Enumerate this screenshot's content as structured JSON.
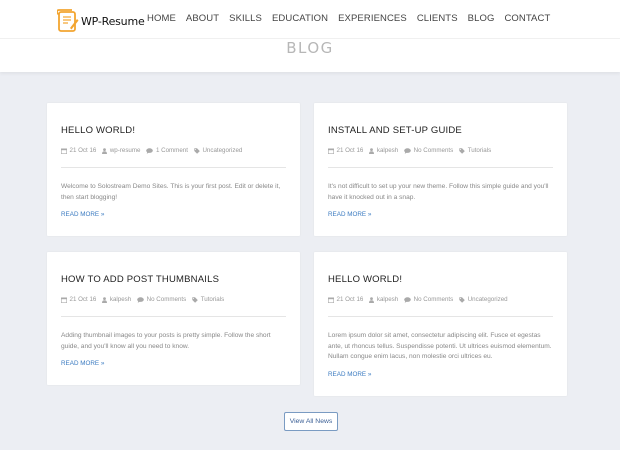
{
  "brand": {
    "logo_text": "WP-Resume"
  },
  "nav": {
    "items": [
      "HOME",
      "ABOUT",
      "SKILLS",
      "EDUCATION",
      "EXPERIENCES",
      "CLIENTS",
      "BLOG",
      "CONTACT"
    ]
  },
  "page": {
    "title": "BLOG"
  },
  "posts": [
    {
      "title": "HELLO WORLD!",
      "date": "21 Oct 16",
      "author": "wp-resume",
      "comments": "1 Comment",
      "category": "Uncategorized",
      "excerpt": "Welcome to Solostream Demo Sites. This is your first post. Edit or delete it, then start blogging!",
      "more": "READ MORE"
    },
    {
      "title": "INSTALL AND SET-UP GUIDE",
      "date": "21 Oct 16",
      "author": "kalpesh",
      "comments": "No Comments",
      "category": "Tutorials",
      "excerpt": "It's not difficult to set up your new theme. Follow this simple guide and you'll have it knocked out in a snap.",
      "more": "READ MORE"
    },
    {
      "title": "HOW TO ADD POST THUMBNAILS",
      "date": "21 Oct 16",
      "author": "kalpesh",
      "comments": "No Comments",
      "category": "Tutorials",
      "excerpt": "Adding thumbnail images to your posts is pretty simple. Follow the short guide, and you'll know all you need to know.",
      "more": "READ MORE"
    },
    {
      "title": "HELLO WORLD!",
      "date": "21 Oct 16",
      "author": "kalpesh",
      "comments": "No Comments",
      "category": "Uncategorized",
      "excerpt": "Lorem ipsum dolor sit amet, consectetur adipiscing elit. Fusce et egestas ante, ut rhoncus tellus. Suspendisse potenti. Ut ultrices euismod elementum. Nullam congue enim lacus, non molestie orci ultrices eu.",
      "more": "READ MORE"
    }
  ],
  "footer": {
    "view_all_label": "View All News"
  },
  "colors": {
    "link": "#3b7bc1",
    "background": "#eceef3",
    "logo_accent": "#f3a530"
  },
  "icons": [
    "scroll-logo-icon",
    "calendar-icon",
    "user-icon",
    "comment-icon",
    "tag-icon",
    "chevron-right-icon"
  ]
}
